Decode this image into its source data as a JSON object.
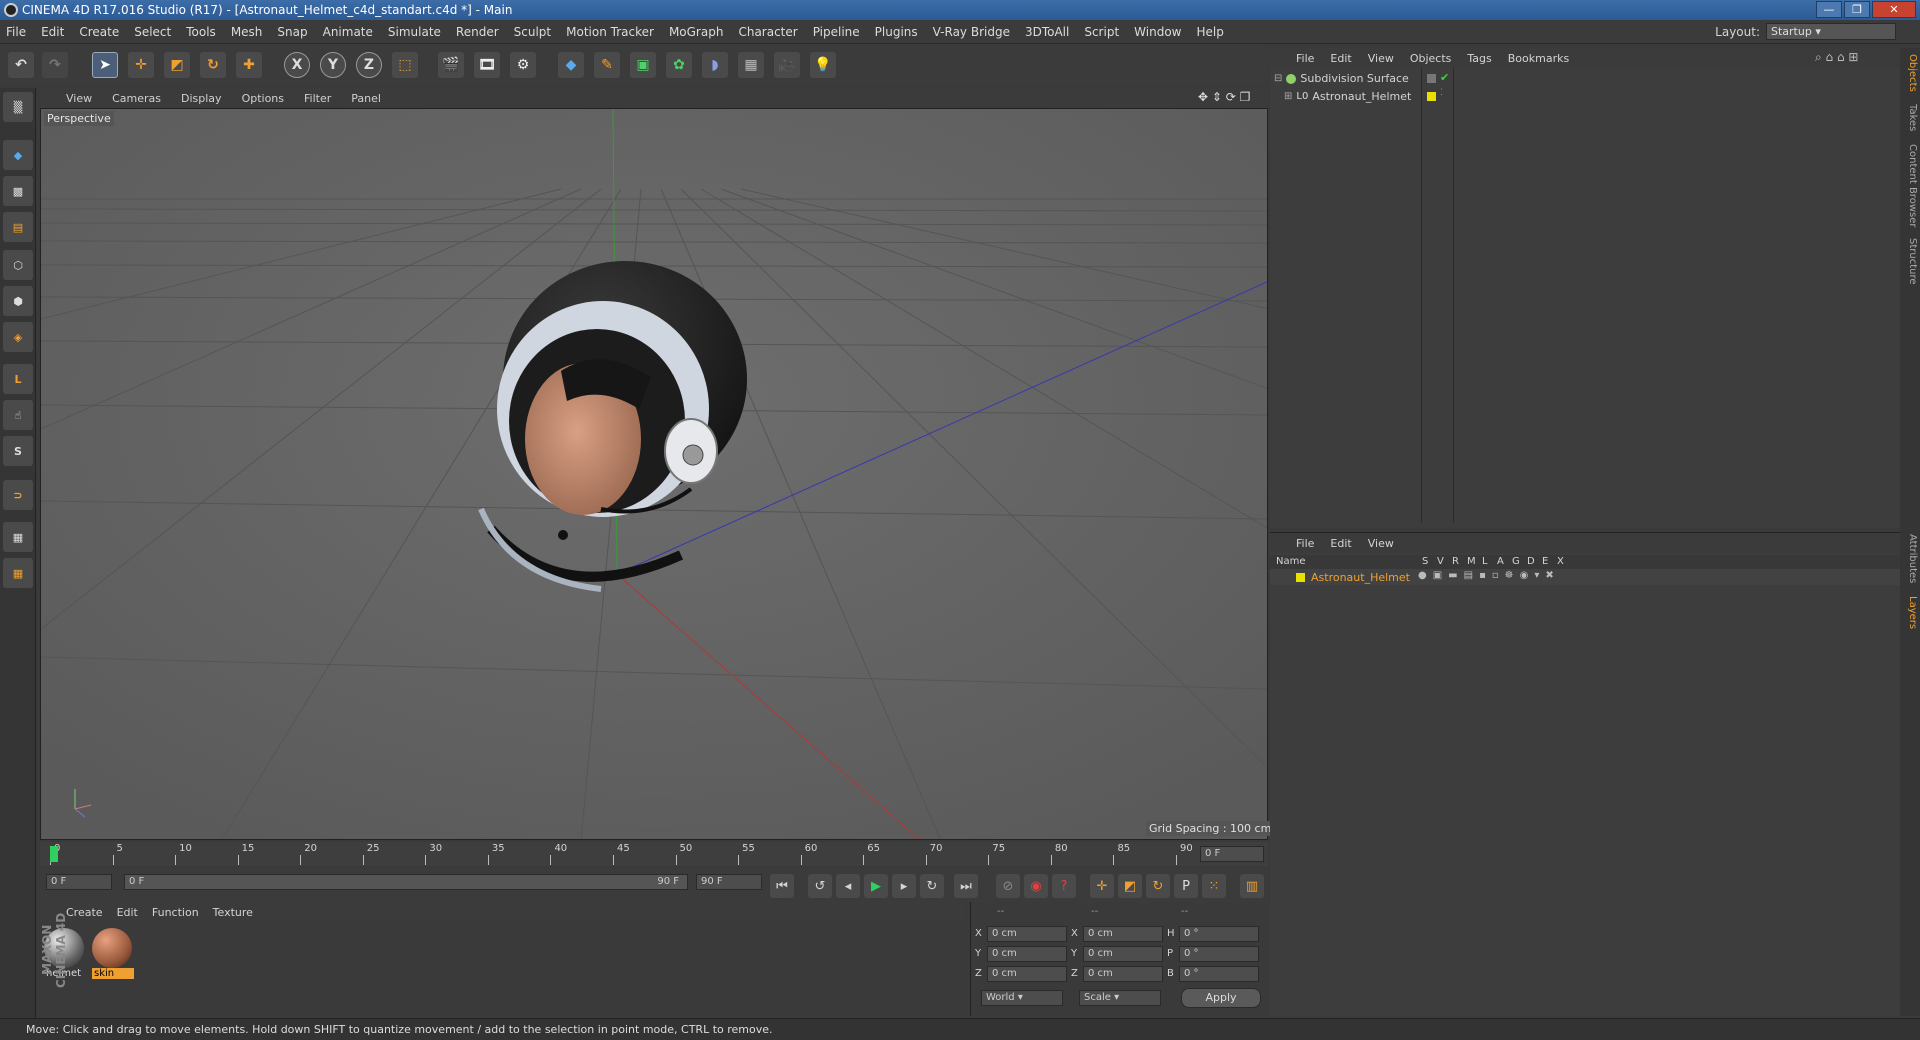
{
  "window": {
    "title": "CINEMA 4D R17.016 Studio (R17) - [Astronaut_Helmet_c4d_standart.c4d *] - Main"
  },
  "menubar": [
    "File",
    "Edit",
    "Create",
    "Select",
    "Tools",
    "Mesh",
    "Snap",
    "Animate",
    "Simulate",
    "Render",
    "Sculpt",
    "Motion Tracker",
    "MoGraph",
    "Character",
    "Pipeline",
    "Plugins",
    "V-Ray Bridge",
    "3DToAll",
    "Script",
    "Window",
    "Help"
  ],
  "layout": {
    "label": "Layout:",
    "value": "Startup"
  },
  "viewport": {
    "menu": [
      "View",
      "Cameras",
      "Display",
      "Options",
      "Filter",
      "Panel"
    ],
    "camera_label": "Perspective",
    "grid_spacing": "Grid Spacing : 100 cm"
  },
  "timeline": {
    "ticks": [
      "0",
      "5",
      "10",
      "15",
      "20",
      "25",
      "30",
      "35",
      "40",
      "45",
      "50",
      "55",
      "60",
      "65",
      "70",
      "75",
      "80",
      "85",
      "90"
    ],
    "current_frame": "0 F"
  },
  "controls": {
    "start": "0 F",
    "range_start": "0 F",
    "range_end": "90 F",
    "end": "90 F"
  },
  "materials": {
    "menu": [
      "Create",
      "Edit",
      "Function",
      "Texture"
    ],
    "items": [
      {
        "name": "helmet",
        "selected": false
      },
      {
        "name": "skin",
        "selected": true
      }
    ]
  },
  "coordinates": {
    "headers": [
      "--",
      "--",
      "--"
    ],
    "rows": [
      {
        "a": "X",
        "av": "0 cm",
        "b": "X",
        "bv": "0 cm",
        "c": "H",
        "cv": "0 °"
      },
      {
        "a": "Y",
        "av": "0 cm",
        "b": "Y",
        "bv": "0 cm",
        "c": "P",
        "cv": "0 °"
      },
      {
        "a": "Z",
        "av": "0 cm",
        "b": "Z",
        "bv": "0 cm",
        "c": "B",
        "cv": "0 °"
      }
    ],
    "world": "World",
    "scale": "Scale",
    "apply": "Apply"
  },
  "object_manager": {
    "menu": [
      "File",
      "Edit",
      "View",
      "Objects",
      "Tags",
      "Bookmarks"
    ],
    "objects": [
      {
        "name": "Subdivision Surface",
        "color": "#8fd06a"
      },
      {
        "name": "Astronaut_Helmet",
        "color": "#e8e000"
      }
    ]
  },
  "layer_manager": {
    "menu": [
      "File",
      "Edit",
      "View"
    ],
    "columns": [
      "Name",
      "S",
      "V",
      "R",
      "M",
      "L",
      "A",
      "G",
      "D",
      "E",
      "X"
    ],
    "layers": [
      {
        "name": "Astronaut_Helmet",
        "color": "#e8e000"
      }
    ]
  },
  "side_tabs": [
    "Objects",
    "Takes",
    "Content Browser",
    "Structure",
    "Attributes",
    "Layers"
  ],
  "status": "Move: Click and drag to move elements. Hold down SHIFT to quantize movement / add to the selection in point mode, CTRL to remove.",
  "brand": "MAXON CINEMA 4D"
}
